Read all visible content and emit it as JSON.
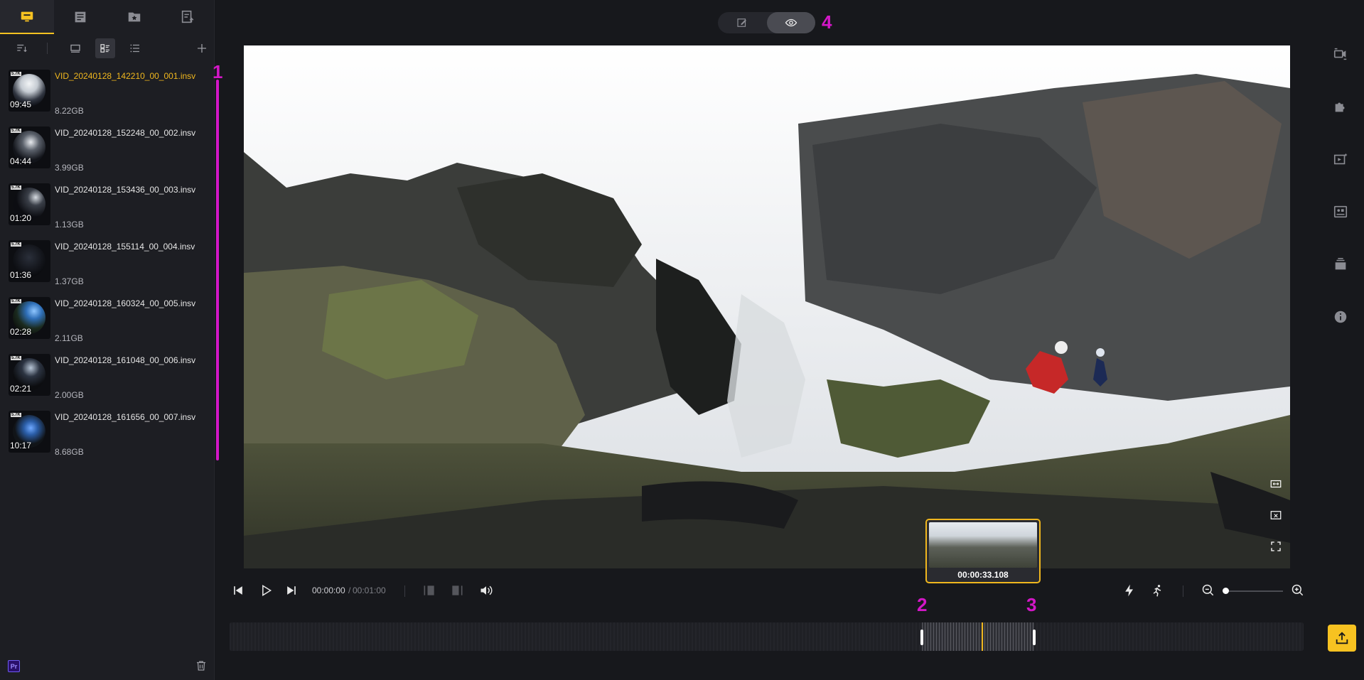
{
  "sidebar": {
    "tabs": [
      {
        "icon": "computer-icon",
        "active": true
      },
      {
        "icon": "sd-card-icon",
        "active": false
      },
      {
        "icon": "favorites-icon",
        "active": false
      },
      {
        "icon": "export-list-icon",
        "active": false
      }
    ],
    "toolbar": {
      "sort_icon": "sort-icon",
      "view_modes": [
        "large-thumbnail-icon",
        "grid-list-icon",
        "list-icon"
      ],
      "selected_view": "grid-list-icon",
      "add_icon": "plus-icon"
    },
    "files": [
      {
        "name": "VID_20240128_142210_00_001.insv",
        "duration": "09:45",
        "size": "8.22GB",
        "active": true
      },
      {
        "name": "VID_20240128_152248_00_002.insv",
        "duration": "04:44",
        "size": "3.99GB",
        "active": false
      },
      {
        "name": "VID_20240128_153436_00_003.insv",
        "duration": "01:20",
        "size": "1.13GB",
        "active": false
      },
      {
        "name": "VID_20240128_155114_00_004.insv",
        "duration": "01:36",
        "size": "1.37GB",
        "active": false
      },
      {
        "name": "VID_20240128_160324_00_005.insv",
        "duration": "02:28",
        "size": "2.11GB",
        "active": false
      },
      {
        "name": "VID_20240128_161048_00_006.insv",
        "duration": "02:21",
        "size": "2.00GB",
        "active": false
      },
      {
        "name": "VID_20240128_161656_00_007.insv",
        "duration": "10:17",
        "size": "8.68GB",
        "active": false
      }
    ],
    "thumb_badge": "5.7K",
    "premiere_badge": "Pr"
  },
  "annotations": {
    "one": "1",
    "two": "2",
    "three": "3",
    "four": "4"
  },
  "mode_toggle": {
    "edit_icon": "edit-icon",
    "view_icon": "eye-icon",
    "selected": "view"
  },
  "preview": {
    "time": "00:00:33.108"
  },
  "playback": {
    "current": "00:00:00",
    "separator": "/",
    "total": "00:01:00",
    "zoom_level": 0.0
  },
  "timeline": {
    "trim_start_fraction": 0.6447,
    "trim_end_fraction": 0.7494,
    "playhead_fraction": 0.7009
  },
  "right_rail": [
    "camera-settings-icon",
    "plugin-icon",
    "video-effects-icon",
    "stabilization-icon",
    "layers-icon",
    "info-icon"
  ],
  "colors": {
    "accent": "#f7c221",
    "annotation": "#d317c7",
    "active_file": "#f0b71e"
  }
}
